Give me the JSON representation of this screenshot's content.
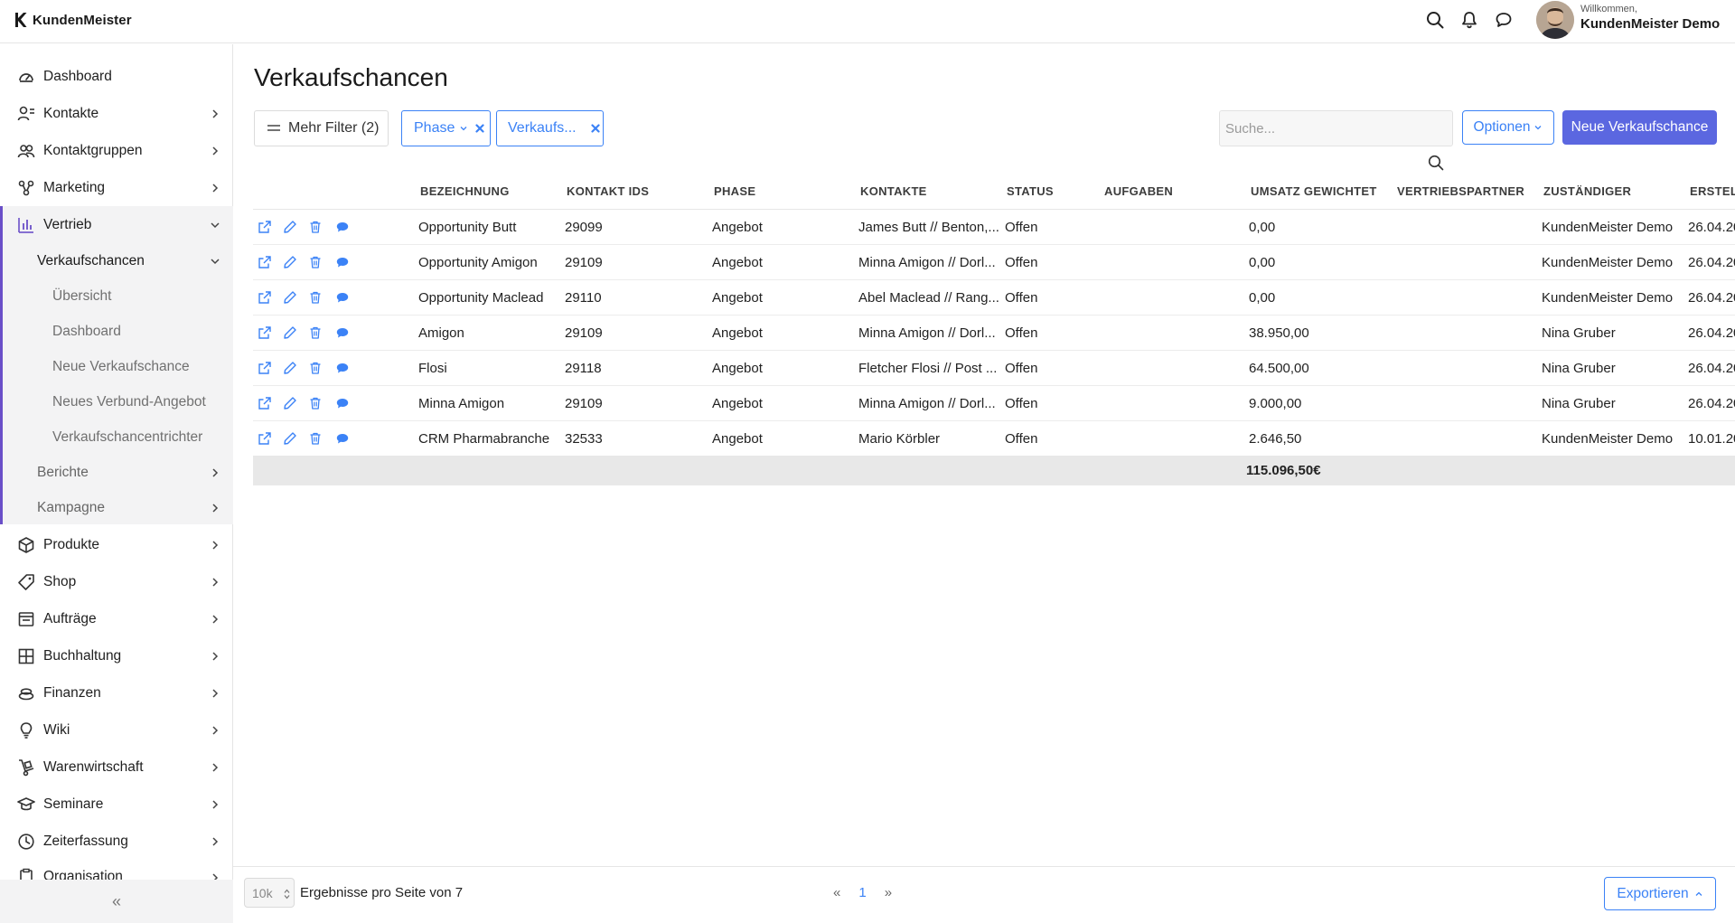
{
  "app": {
    "name": "KundenMeister"
  },
  "header": {
    "welcome_small": "Willkommen,",
    "user_name": "KundenMeister Demo"
  },
  "sidebar": {
    "items": [
      {
        "label": "Dashboard",
        "icon": "dashboard-icon"
      },
      {
        "label": "Kontakte",
        "icon": "contacts-icon"
      },
      {
        "label": "Kontaktgruppen",
        "icon": "groups-icon"
      },
      {
        "label": "Marketing",
        "icon": "marketing-icon"
      },
      {
        "label": "Vertrieb",
        "icon": "chart-icon"
      },
      {
        "label": "Produkte",
        "icon": "box-icon"
      },
      {
        "label": "Shop",
        "icon": "tag-icon"
      },
      {
        "label": "Aufträge",
        "icon": "orders-icon"
      },
      {
        "label": "Buchhaltung",
        "icon": "accounting-icon"
      },
      {
        "label": "Finanzen",
        "icon": "coins-icon"
      },
      {
        "label": "Wiki",
        "icon": "bulb-icon"
      },
      {
        "label": "Warenwirtschaft",
        "icon": "handtruck-icon"
      },
      {
        "label": "Seminare",
        "icon": "graduation-icon"
      },
      {
        "label": "Zeiterfassung",
        "icon": "clock-icon"
      },
      {
        "label": "Organisation",
        "icon": "clipboard-icon"
      }
    ],
    "vertrieb_sub": {
      "verkaufschancen": "Verkaufschancen",
      "children": [
        "Übersicht",
        "Dashboard",
        "Neue Verkaufschance",
        "Neues Verbund-Angebot",
        "Verkaufschancentrichter"
      ],
      "berichte": "Berichte",
      "kampagne": "Kampagne"
    },
    "collapse_label": "«"
  },
  "page": {
    "title": "Verkaufschancen",
    "filters": {
      "more": "Mehr Filter (2)",
      "phase": "Phase",
      "verkaufs": "Verkaufs..."
    },
    "search_placeholder": "Suche...",
    "options_label": "Optionen",
    "new_label": "Neue Verkaufschance"
  },
  "table": {
    "columns": [
      "BEZEICHNUNG",
      "KONTAKT IDS",
      "PHASE",
      "KONTAKTE",
      "STATUS",
      "AUFGABEN",
      "UMSATZ GEWICHTET",
      "VERTRIEBSPARTNER",
      "ZUSTÄNDIGER",
      "ERSTELL"
    ],
    "rows": [
      [
        "Opportunity Butt",
        "29099",
        "Angebot",
        "James Butt // Benton,...",
        "Offen",
        "",
        "0,00",
        "",
        "KundenMeister Demo",
        "26.04.20"
      ],
      [
        "Opportunity Amigon",
        "29109",
        "Angebot",
        "Minna Amigon // Dorl...",
        "Offen",
        "",
        "0,00",
        "",
        "KundenMeister Demo",
        "26.04.20"
      ],
      [
        "Opportunity Maclead",
        "29110",
        "Angebot",
        "Abel Maclead // Rang...",
        "Offen",
        "",
        "0,00",
        "",
        "KundenMeister Demo",
        "26.04.20"
      ],
      [
        "Amigon",
        "29109",
        "Angebot",
        "Minna Amigon // Dorl...",
        "Offen",
        "",
        "38.950,00",
        "",
        "Nina Gruber",
        "26.04.20"
      ],
      [
        "Flosi",
        "29118",
        "Angebot",
        "Fletcher Flosi // Post ...",
        "Offen",
        "",
        "64.500,00",
        "",
        "Nina Gruber",
        "26.04.20"
      ],
      [
        "Minna Amigon",
        "29109",
        "Angebot",
        "Minna Amigon // Dorl...",
        "Offen",
        "",
        "9.000,00",
        "",
        "Nina Gruber",
        "26.04.20"
      ],
      [
        "CRM Pharmabranche",
        "32533",
        "Angebot",
        "Mario Körbler",
        "Offen",
        "",
        "2.646,50",
        "",
        "KundenMeister Demo",
        "10.01.20"
      ]
    ],
    "sum": "115.096,50€"
  },
  "footer": {
    "per_page_value": "10k",
    "per_page_text": "Ergebnisse pro Seite von 7",
    "prev": "«",
    "page": "1",
    "next": "»",
    "export_label": "Exportieren"
  },
  "colors": {
    "accent": "#3b82f6",
    "primary_button": "#5b67e0",
    "sidebar_active_border": "#6a4fc8"
  }
}
